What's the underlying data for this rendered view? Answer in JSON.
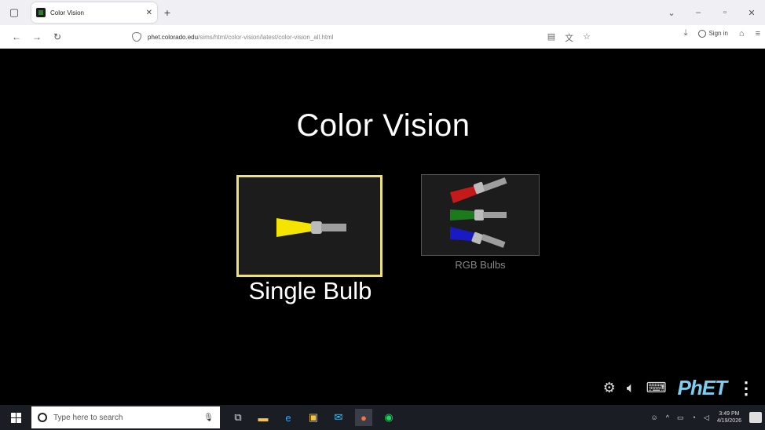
{
  "browser": {
    "tab_title": "Color Vision",
    "url_host": "phet.colorado.edu",
    "url_path": "/sims/html/color-vision/latest/color-vision_all.html",
    "sign_in": "Sign in"
  },
  "sim": {
    "title": "Color Vision",
    "screens": [
      {
        "label": "Single Bulb",
        "selected": true
      },
      {
        "label": "RGB Bulbs",
        "selected": false
      }
    ],
    "brand": "PhET",
    "colors": {
      "selected_border": "#ede07f",
      "yellow_beam": "#f5e400",
      "red_beam": "#c41a1a",
      "green_beam": "#1b7a1b",
      "blue_beam": "#1a1ac4"
    }
  },
  "taskbar": {
    "search_placeholder": "Type here to search",
    "time": "3:49 PM",
    "date": "4/19/2026"
  }
}
